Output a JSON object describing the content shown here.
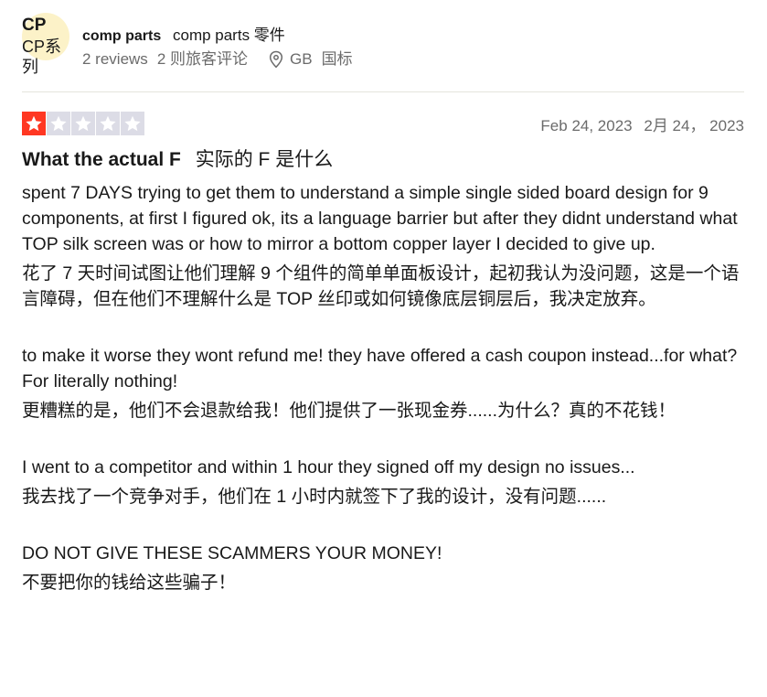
{
  "consumer": {
    "initials": "CP",
    "initials_translated": "CP系列",
    "name": "comp parts",
    "name_translated": "comp parts 零件",
    "reviews_count": "2 reviews",
    "reviews_count_translated": "2 则旅客评论",
    "location_code": "GB",
    "location_translated": "国标",
    "location_icon": "location-pin-icon"
  },
  "review": {
    "rating": 1,
    "rating_max": 5,
    "star_filled_color": "#ff3722",
    "star_empty_color": "#dcdce6",
    "date": "Feb 24, 2023",
    "date_translated": "2月 24， 2023",
    "title": "What the actual F",
    "title_translated": "实际的 F 是什么",
    "paragraphs": [
      {
        "text": "spent 7 DAYS trying to get them to understand a simple single sided board design for 9 components, at first I figured ok, its a language barrier but after they didnt understand what TOP silk screen was or how to mirror a bottom copper layer I decided to give up.",
        "translated": "花了 7 天时间试图让他们理解 9 个组件的简单单面板设计，起初我认为没问题，这是一个语言障碍，但在他们不理解什么是 TOP 丝印或如何镜像底层铜层后，我决定放弃。"
      },
      {
        "text": "to make it worse they wont refund me! they have offered a cash coupon instead...for what? For literally nothing!",
        "translated": "更糟糕的是，他们不会退款给我！他们提供了一张现金券......为什么？真的不花钱！"
      },
      {
        "text": "I went to a competitor and within 1 hour they signed off my design no issues...",
        "translated": "我去找了一个竞争对手，他们在 1 小时内就签下了我的设计，没有问题......"
      },
      {
        "text": "DO NOT GIVE THESE SCAMMERS YOUR MONEY!",
        "translated": "不要把你的钱给这些骗子！"
      }
    ]
  }
}
